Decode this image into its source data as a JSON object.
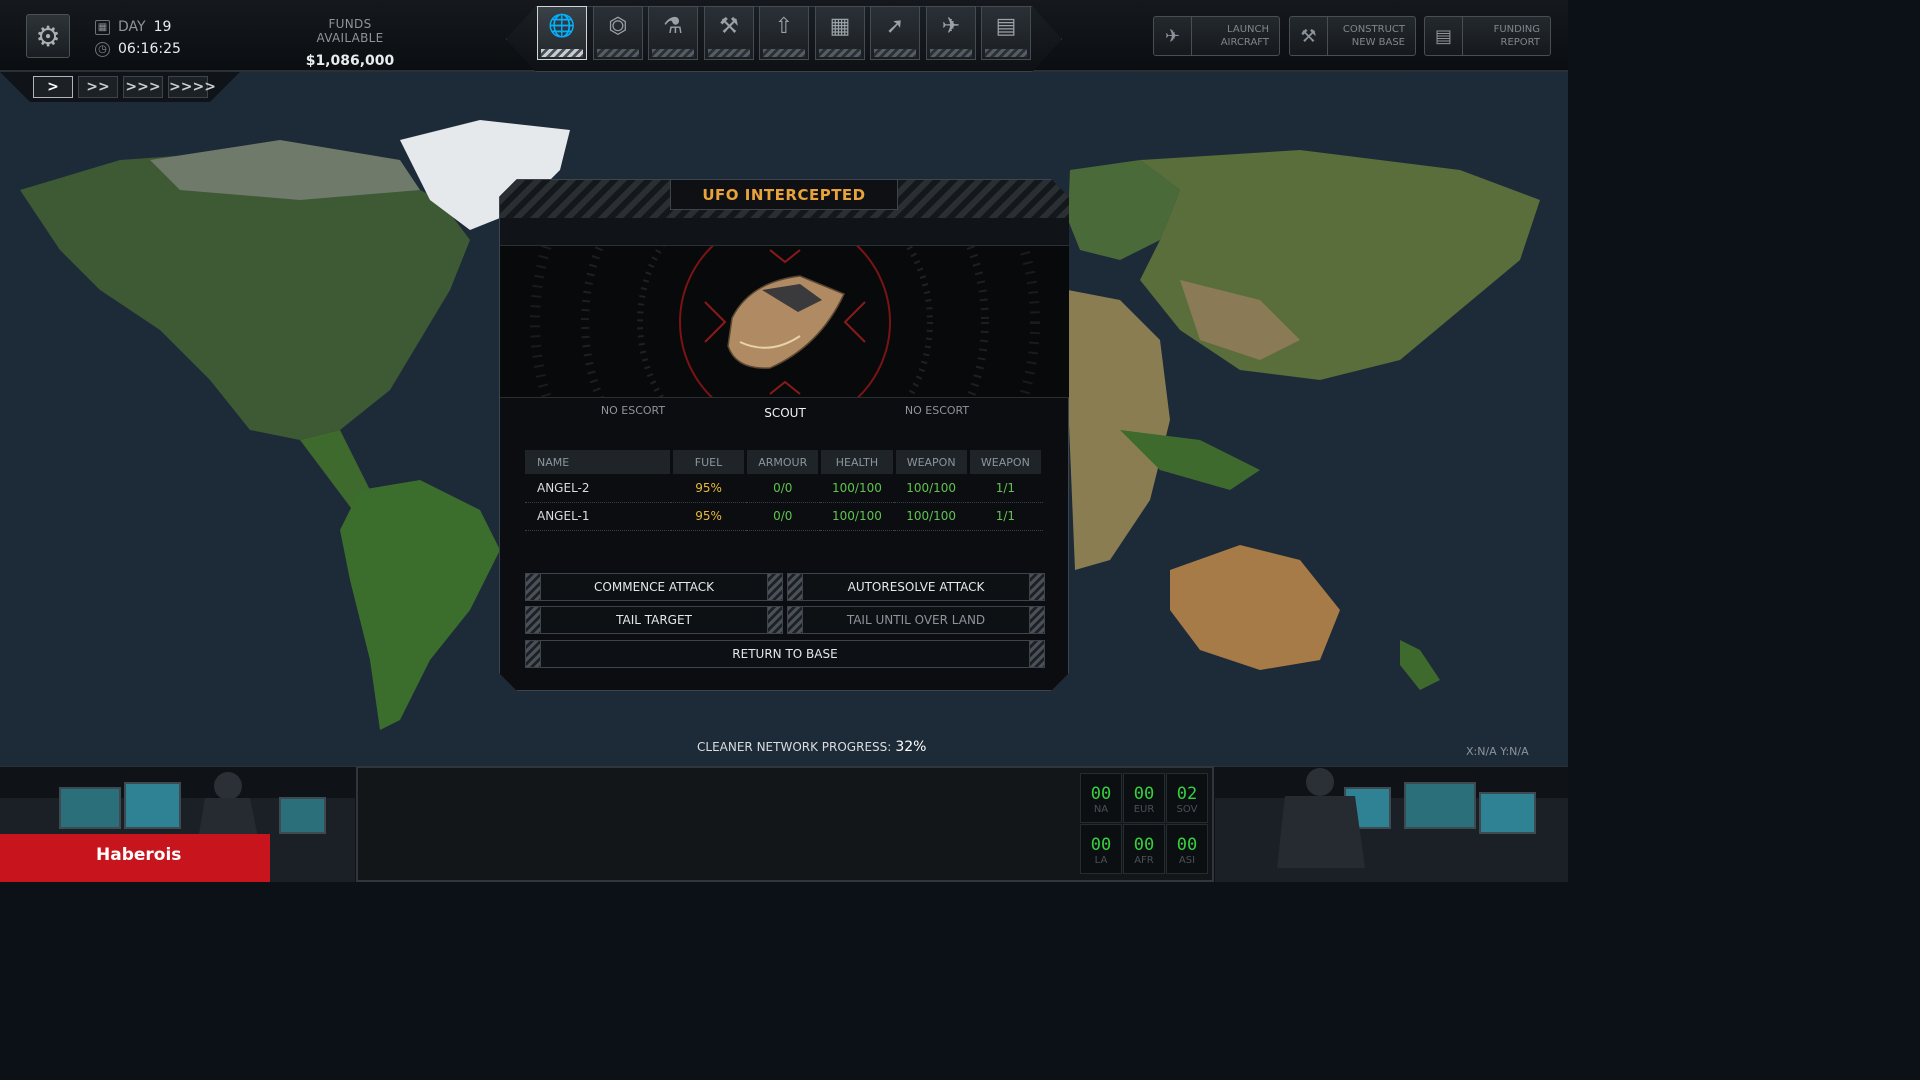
{
  "topbar": {
    "day_label": "DAY",
    "day_value": "19",
    "time": "06:16:25",
    "funds_label": "FUNDS AVAILABLE",
    "funds_value": "$1,086,000",
    "nav": [
      {
        "name": "geoscape",
        "icon": "globe-icon",
        "active": true
      },
      {
        "name": "base",
        "icon": "hangar-icon"
      },
      {
        "name": "research",
        "icon": "microscope-icon"
      },
      {
        "name": "engineering",
        "icon": "tools-icon"
      },
      {
        "name": "soldiers",
        "icon": "rank-icon"
      },
      {
        "name": "stores",
        "icon": "stores-icon"
      },
      {
        "name": "armory",
        "icon": "rifle-icon"
      },
      {
        "name": "hangar",
        "icon": "jet-icon"
      },
      {
        "name": "archives",
        "icon": "cabinet-icon"
      }
    ],
    "actions": [
      {
        "label": "LAUNCH\nAIRCRAFT",
        "icon": "aircraft-icon"
      },
      {
        "label": "CONSTRUCT\nNEW BASE",
        "icon": "excavator-icon"
      },
      {
        "label": "FUNDING\nREPORT",
        "icon": "document-icon"
      }
    ],
    "speeds": [
      ">",
      ">>",
      ">>>",
      ">>>>"
    ]
  },
  "modal": {
    "title": "UFO INTERCEPTED",
    "escort_left": "NO ESCORT",
    "escort_right": "NO ESCORT",
    "ufo_type": "SCOUT",
    "columns": [
      "NAME",
      "FUEL",
      "ARMOUR",
      "HEALTH",
      "WEAPON",
      "WEAPON"
    ],
    "rows": [
      {
        "name": "ANGEL-2",
        "fuel": "95%",
        "armour": "0/0",
        "health": "100/100",
        "weapon1": "100/100",
        "weapon2": "1/1"
      },
      {
        "name": "ANGEL-1",
        "fuel": "95%",
        "armour": "0/0",
        "health": "100/100",
        "weapon1": "100/100",
        "weapon2": "1/1"
      }
    ],
    "commands": {
      "commence_attack": "COMMENCE ATTACK",
      "autoresolve_attack": "AUTORESOLVE ATTACK",
      "tail_target": "TAIL TARGET",
      "tail_until_over_land": "TAIL UNTIL OVER LAND",
      "return_to_base": "RETURN TO BASE"
    }
  },
  "status": {
    "progress_label": "CLEANER NETWORK PROGRESS:",
    "progress_value": "32%",
    "coords": "X:N/A   Y:N/A"
  },
  "counters": [
    {
      "value": "00",
      "region": "NA"
    },
    {
      "value": "00",
      "region": "EUR"
    },
    {
      "value": "02",
      "region": "SOV"
    },
    {
      "value": "00",
      "region": "LA"
    },
    {
      "value": "00",
      "region": "AFR"
    },
    {
      "value": "00",
      "region": "ASI"
    }
  ],
  "region_tag": "Haberois",
  "colors": {
    "accent": "#e8a33a",
    "good": "#5fc34f",
    "fuel": "#e8b93a",
    "alert": "#c8141d",
    "counter": "#35d140"
  }
}
